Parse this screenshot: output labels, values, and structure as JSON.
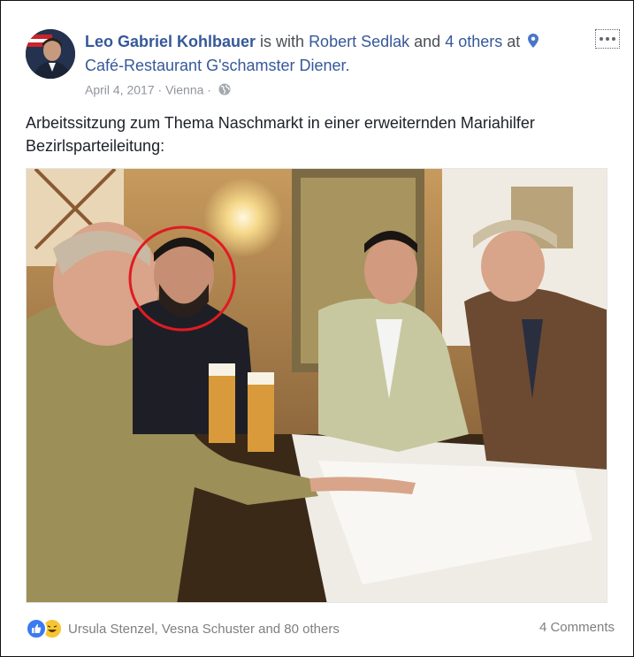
{
  "post": {
    "author": "Leo Gabriel Kohlbauer",
    "with_text": " is with ",
    "tagged_person": "Robert Sedlak",
    "and_text": " and ",
    "others_link": "4 others",
    "at_text": " at",
    "place": "Café-Restaurant G'schamster Diener.",
    "date": "April 4, 2017",
    "separator": " · ",
    "location": "Vienna",
    "body": "Arbeitssitzung zum Thema Naschmarkt in einer erweiternden Mariahilfer Bezirlsparteileitung:"
  },
  "footer": {
    "reaction_names": "Ursula Stenzel, Vesna Schuster and 80 others",
    "comments": "4 Comments"
  },
  "icons": {
    "more": "more-options-icon",
    "pin": "location-pin-icon",
    "globe": "public-globe-icon",
    "like": "like-reaction-icon",
    "haha": "haha-reaction-icon"
  },
  "colors": {
    "link": "#365899",
    "meta": "#90949c",
    "highlight_circle": "#e01b22"
  }
}
